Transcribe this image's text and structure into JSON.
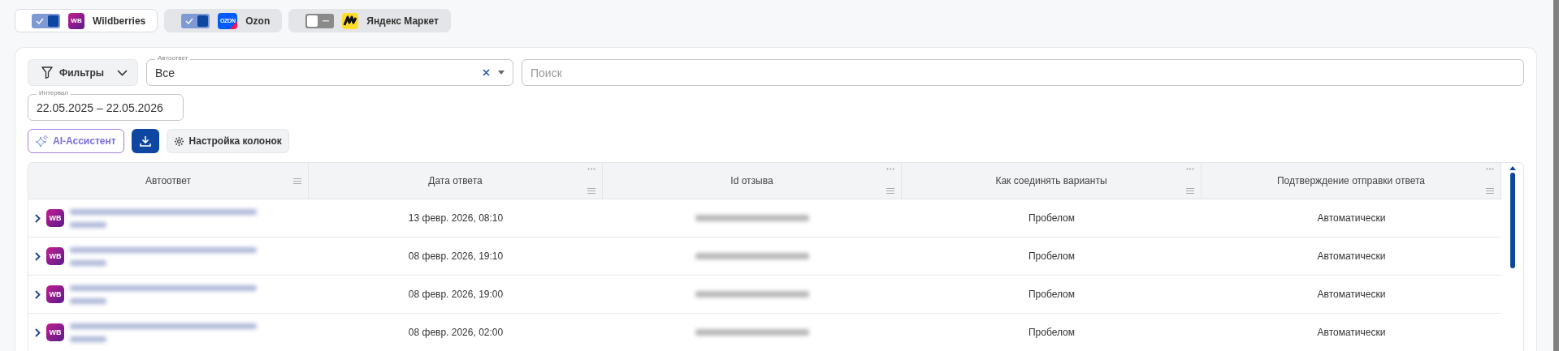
{
  "marketplaces": [
    {
      "name": "Wildberries",
      "logo": {
        "kind": "wb",
        "text": "WB"
      },
      "on": true,
      "selected": true
    },
    {
      "name": "Ozon",
      "logo": {
        "kind": "ozon",
        "text": "OZON"
      },
      "on": true,
      "selected": false
    },
    {
      "name": "Яндекс Маркет",
      "logo": {
        "kind": "yandex"
      },
      "on": false,
      "selected": false
    }
  ],
  "filters": {
    "button": "Фильтры",
    "autoreply": {
      "label": "Автоответ",
      "value": "Все"
    },
    "search": {
      "placeholder": "Поиск"
    },
    "interval": {
      "label": "Интервал",
      "value": "22.05.2025 – 22.05.2026"
    }
  },
  "toolbar": {
    "ai_button": "AI-Ассистент",
    "columns_button": "Настройка колонок"
  },
  "table": {
    "columns": [
      {
        "title": "Автоответ",
        "has_menu": false
      },
      {
        "title": "Дата ответа",
        "has_menu": true
      },
      {
        "title": "Id отзыва",
        "has_menu": true
      },
      {
        "title": "Как соединять варианты",
        "has_menu": true
      },
      {
        "title": "Подтверждение отправки ответа",
        "has_menu": true
      }
    ],
    "rows": [
      {
        "badge": "WB",
        "date": "13 февр. 2026, 08:10",
        "join": "Пробелом",
        "confirm": "Автоматически"
      },
      {
        "badge": "WB",
        "date": "08 февр. 2026, 19:10",
        "join": "Пробелом",
        "confirm": "Автоматически"
      },
      {
        "badge": "WB",
        "date": "08 февр. 2026, 19:00",
        "join": "Пробелом",
        "confirm": "Автоматически"
      },
      {
        "badge": "WB",
        "date": "08 февр. 2026, 02:00",
        "join": "Пробелом",
        "confirm": "Автоматически"
      }
    ]
  }
}
